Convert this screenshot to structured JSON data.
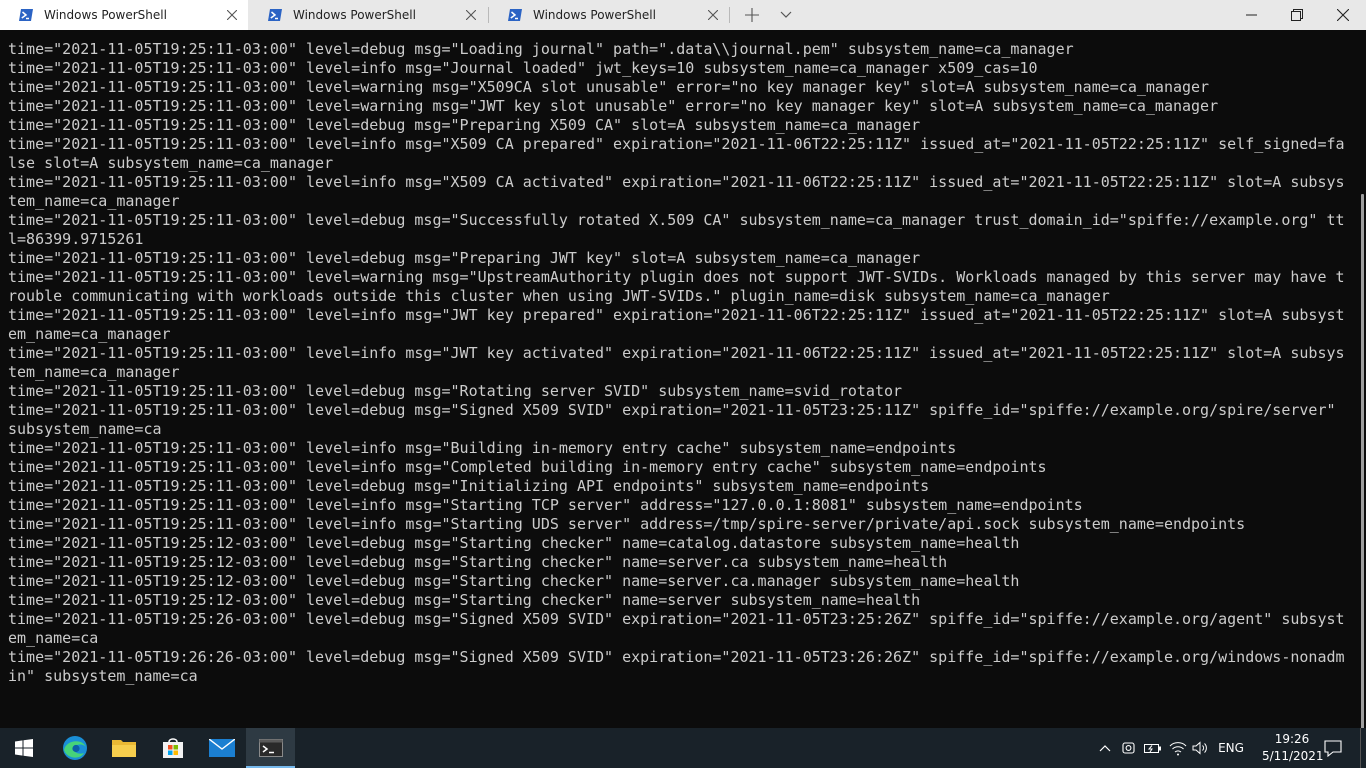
{
  "tabs": [
    {
      "title": "Windows PowerShell",
      "active": true
    },
    {
      "title": "Windows PowerShell",
      "active": false
    },
    {
      "title": "Windows PowerShell",
      "active": false
    }
  ],
  "window_controls": [
    "new-tab",
    "dropdown",
    "minimize",
    "maximize",
    "close"
  ],
  "terminal": {
    "background": "#0c0c0c",
    "foreground": "#cccccc",
    "lines": [
      "time=\"2021-11-05T19:25:11-03:00\" level=debug msg=\"Loading journal\" path=\".data\\\\journal.pem\" subsystem_name=ca_manager",
      "time=\"2021-11-05T19:25:11-03:00\" level=info msg=\"Journal loaded\" jwt_keys=10 subsystem_name=ca_manager x509_cas=10",
      "time=\"2021-11-05T19:25:11-03:00\" level=warning msg=\"X509CA slot unusable\" error=\"no key manager key\" slot=A subsystem_name=ca_manager",
      "time=\"2021-11-05T19:25:11-03:00\" level=warning msg=\"JWT key slot unusable\" error=\"no key manager key\" slot=A subsystem_name=ca_manager",
      "time=\"2021-11-05T19:25:11-03:00\" level=debug msg=\"Preparing X509 CA\" slot=A subsystem_name=ca_manager",
      "time=\"2021-11-05T19:25:11-03:00\" level=info msg=\"X509 CA prepared\" expiration=\"2021-11-06T22:25:11Z\" issued_at=\"2021-11-05T22:25:11Z\" self_signed=fa",
      "lse slot=A subsystem_name=ca_manager",
      "time=\"2021-11-05T19:25:11-03:00\" level=info msg=\"X509 CA activated\" expiration=\"2021-11-06T22:25:11Z\" issued_at=\"2021-11-05T22:25:11Z\" slot=A subsys",
      "tem_name=ca_manager",
      "time=\"2021-11-05T19:25:11-03:00\" level=debug msg=\"Successfully rotated X.509 CA\" subsystem_name=ca_manager trust_domain_id=\"spiffe://example.org\" tt",
      "l=86399.9715261",
      "time=\"2021-11-05T19:25:11-03:00\" level=debug msg=\"Preparing JWT key\" slot=A subsystem_name=ca_manager",
      "time=\"2021-11-05T19:25:11-03:00\" level=warning msg=\"UpstreamAuthority plugin does not support JWT-SVIDs. Workloads managed by this server may have t",
      "rouble communicating with workloads outside this cluster when using JWT-SVIDs.\" plugin_name=disk subsystem_name=ca_manager",
      "time=\"2021-11-05T19:25:11-03:00\" level=info msg=\"JWT key prepared\" expiration=\"2021-11-06T22:25:11Z\" issued_at=\"2021-11-05T22:25:11Z\" slot=A subsyst",
      "em_name=ca_manager",
      "time=\"2021-11-05T19:25:11-03:00\" level=info msg=\"JWT key activated\" expiration=\"2021-11-06T22:25:11Z\" issued_at=\"2021-11-05T22:25:11Z\" slot=A subsys",
      "tem_name=ca_manager",
      "time=\"2021-11-05T19:25:11-03:00\" level=debug msg=\"Rotating server SVID\" subsystem_name=svid_rotator",
      "time=\"2021-11-05T19:25:11-03:00\" level=debug msg=\"Signed X509 SVID\" expiration=\"2021-11-05T23:25:11Z\" spiffe_id=\"spiffe://example.org/spire/server\"",
      "subsystem_name=ca",
      "time=\"2021-11-05T19:25:11-03:00\" level=info msg=\"Building in-memory entry cache\" subsystem_name=endpoints",
      "time=\"2021-11-05T19:25:11-03:00\" level=info msg=\"Completed building in-memory entry cache\" subsystem_name=endpoints",
      "time=\"2021-11-05T19:25:11-03:00\" level=debug msg=\"Initializing API endpoints\" subsystem_name=endpoints",
      "time=\"2021-11-05T19:25:11-03:00\" level=info msg=\"Starting TCP server\" address=\"127.0.0.1:8081\" subsystem_name=endpoints",
      "time=\"2021-11-05T19:25:11-03:00\" level=info msg=\"Starting UDS server\" address=/tmp/spire-server/private/api.sock subsystem_name=endpoints",
      "time=\"2021-11-05T19:25:12-03:00\" level=debug msg=\"Starting checker\" name=catalog.datastore subsystem_name=health",
      "time=\"2021-11-05T19:25:12-03:00\" level=debug msg=\"Starting checker\" name=server.ca subsystem_name=health",
      "time=\"2021-11-05T19:25:12-03:00\" level=debug msg=\"Starting checker\" name=server.ca.manager subsystem_name=health",
      "time=\"2021-11-05T19:25:12-03:00\" level=debug msg=\"Starting checker\" name=server subsystem_name=health",
      "time=\"2021-11-05T19:25:26-03:00\" level=debug msg=\"Signed X509 SVID\" expiration=\"2021-11-05T23:25:26Z\" spiffe_id=\"spiffe://example.org/agent\" subsyst",
      "em_name=ca",
      "time=\"2021-11-05T19:26:26-03:00\" level=debug msg=\"Signed X509 SVID\" expiration=\"2021-11-05T23:26:26Z\" spiffe_id=\"spiffe://example.org/windows-nonadm",
      "in\" subsystem_name=ca"
    ]
  },
  "taskbar": {
    "pinned": [
      "windows-start-icon",
      "edge-icon",
      "file-explorer-icon",
      "microsoft-store-icon",
      "mail-icon",
      "windows-terminal-icon"
    ],
    "tray": {
      "language": "ENG",
      "time": "19:26",
      "date": "5/11/2021"
    }
  },
  "colors": {
    "tabbar": "#e8e8e8",
    "active_tab": "#ffffff",
    "taskbar": "#192229",
    "ps_icon_blue": "#2b63c4"
  }
}
